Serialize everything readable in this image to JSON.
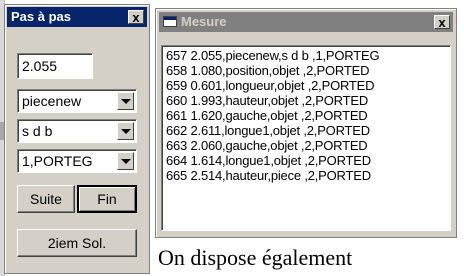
{
  "pas_a_pas": {
    "title": "Pas à pas",
    "close_label": "x",
    "value_field": "2.055",
    "combo1": "piecenew",
    "combo2": "s d b",
    "combo3": "1,PORTEG",
    "suite_label": "Suite",
    "fin_label": "Fin",
    "second_solution_label": "2iem Sol."
  },
  "mesure": {
    "title": "Mesure",
    "close_label": "x",
    "rows": [
      "657 2.055,piecenew,s d b  ,1,PORTEG",
      "658 1.080,position,objet  ,2,PORTED",
      "659 0.601,longueur,objet  ,2,PORTED",
      "660 1.993,hauteur,objet  ,2,PORTED",
      "661 1.620,gauche,objet  ,2,PORTED",
      "662 2.611,longue1,objet  ,2,PORTED",
      "663 2.060,gauche,objet  ,2,PORTED",
      "664 1.614,longue1,objet  ,2,PORTED",
      "665 2.514,hauteur,piece  ,2,PORTED"
    ]
  },
  "bottom_text": "On dispose également"
}
